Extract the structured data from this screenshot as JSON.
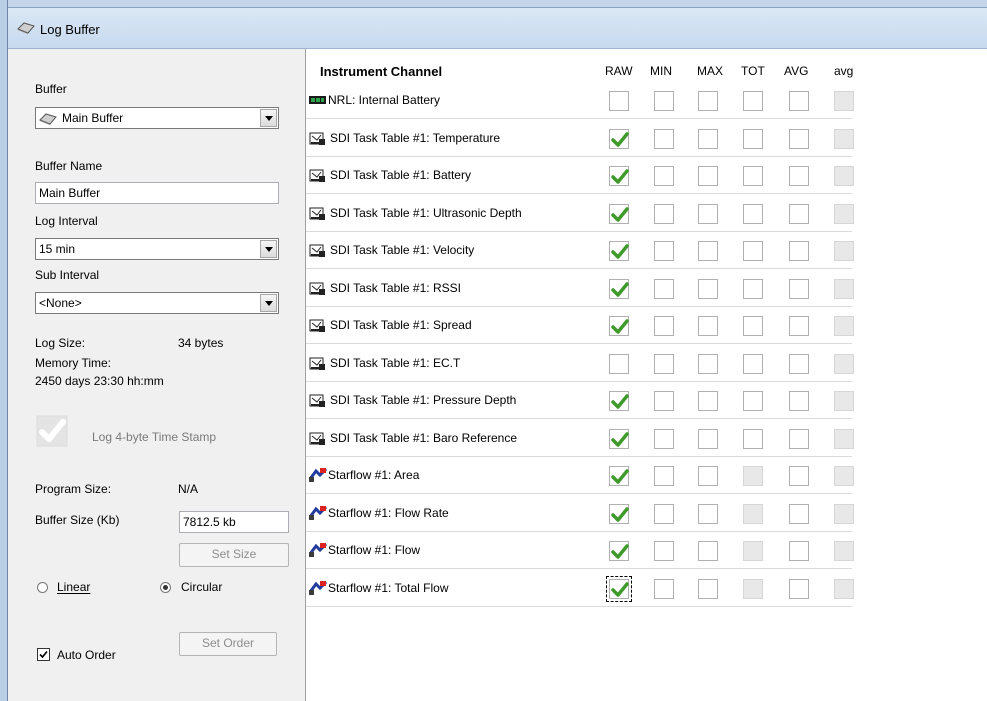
{
  "window": {
    "title": "Log Buffer"
  },
  "left": {
    "buffer_label": "Buffer",
    "buffer_value": "Main Buffer",
    "buffer_name_label": "Buffer Name",
    "buffer_name_value": "Main Buffer",
    "log_interval_label": "Log Interval",
    "log_interval_value": "15 min",
    "sub_interval_label": "Sub Interval",
    "sub_interval_value": "<None>",
    "log_size_label": "Log Size:",
    "log_size_value": "34 bytes",
    "memory_time_label": "Memory Time:",
    "memory_time_value": "2450 days 23:30 hh:mm",
    "timestamp_label": "Log 4-byte Time Stamp",
    "program_size_label": "Program Size:",
    "program_size_value": "N/A",
    "buffer_size_label": "Buffer Size (Kb)",
    "buffer_size_value": "7812.5 kb",
    "set_size_label": "Set Size",
    "linear_label": "Linear",
    "circular_label": "Circular",
    "auto_order_label": "Auto Order",
    "set_order_label": "Set Order"
  },
  "grid": {
    "headers": [
      "Instrument Channel",
      "RAW",
      "MIN",
      "MAX",
      "TOT",
      "AVG",
      "avg"
    ],
    "rows": [
      {
        "label": "NRL: Internal Battery",
        "icon": "battery-icon",
        "raw": false,
        "tot_enabled": true
      },
      {
        "label": "SDI Task Table #1: Temperature",
        "icon": "sdi-task-icon",
        "raw": true,
        "tot_enabled": true
      },
      {
        "label": "SDI Task Table #1: Battery",
        "icon": "sdi-task-icon",
        "raw": true,
        "tot_enabled": true
      },
      {
        "label": "SDI Task Table #1: Ultrasonic Depth",
        "icon": "sdi-task-icon",
        "raw": true,
        "tot_enabled": true
      },
      {
        "label": "SDI Task Table #1: Velocity",
        "icon": "sdi-task-icon",
        "raw": true,
        "tot_enabled": true
      },
      {
        "label": "SDI Task Table #1: RSSI",
        "icon": "sdi-task-icon",
        "raw": true,
        "tot_enabled": true
      },
      {
        "label": "SDI Task Table #1: Spread",
        "icon": "sdi-task-icon",
        "raw": true,
        "tot_enabled": true
      },
      {
        "label": "SDI Task Table #1: EC.T",
        "icon": "sdi-task-icon",
        "raw": false,
        "tot_enabled": true
      },
      {
        "label": "SDI Task Table #1: Pressure Depth",
        "icon": "sdi-task-icon",
        "raw": true,
        "tot_enabled": true
      },
      {
        "label": "SDI Task Table #1: Baro Reference",
        "icon": "sdi-task-icon",
        "raw": true,
        "tot_enabled": true
      },
      {
        "label": "Starflow #1: Area",
        "icon": "starflow-icon",
        "raw": true,
        "tot_enabled": false
      },
      {
        "label": "Starflow #1: Flow Rate",
        "icon": "starflow-icon",
        "raw": true,
        "tot_enabled": false
      },
      {
        "label": "Starflow #1: Flow",
        "icon": "starflow-icon",
        "raw": true,
        "tot_enabled": false
      },
      {
        "label": "Starflow #1: Total Flow",
        "icon": "starflow-icon",
        "raw": true,
        "tot_enabled": false
      }
    ]
  },
  "colors": {
    "check_green": "#3f9a2b",
    "panel_bg": "#f0f0f0",
    "title_bg": "#cfe0f2"
  }
}
